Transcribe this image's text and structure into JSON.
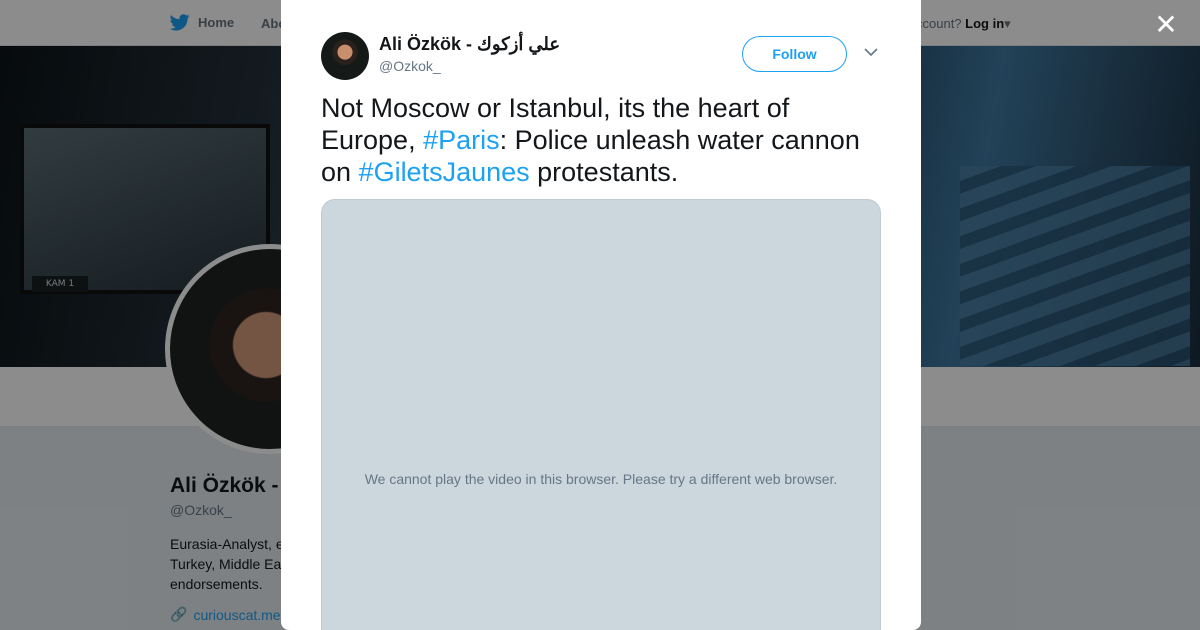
{
  "background_page": {
    "nav": {
      "home_label": "Home",
      "about_label": "Abo",
      "account_prompt": "ccount?",
      "login_label": "Log in"
    },
    "banner": {
      "monitor_tag": "KAM 1"
    },
    "profile": {
      "name": "Ali Özkök -",
      "handle": "@Ozkok_",
      "bio": "Eurasia-Analyst, e Turkey, Middle Ea endorsements.",
      "link": "curiouscat.me/"
    }
  },
  "modal": {
    "author": {
      "name": "Ali Özkök - علي أزكوك",
      "handle": "@Ozkok_"
    },
    "follow_label": "Follow",
    "tweet": {
      "part1": "Not Moscow or Istanbul, its the heart of Europe, ",
      "hashtag1": "#Paris",
      "part2": ": Police unleash water cannon on ",
      "hashtag2": "#GiletsJaunes",
      "part3": " protestants."
    },
    "video_message": "We cannot play the video in this browser. Please try a different web browser."
  },
  "colors": {
    "accent": "#1da1f2",
    "muted": "#657786",
    "text": "#14171a",
    "video_bg": "#ccd6dd"
  },
  "icons": {
    "nav_home": "twitter-bird-icon",
    "close": "close-icon",
    "menu": "chevron-down-icon",
    "link": "link-icon"
  }
}
